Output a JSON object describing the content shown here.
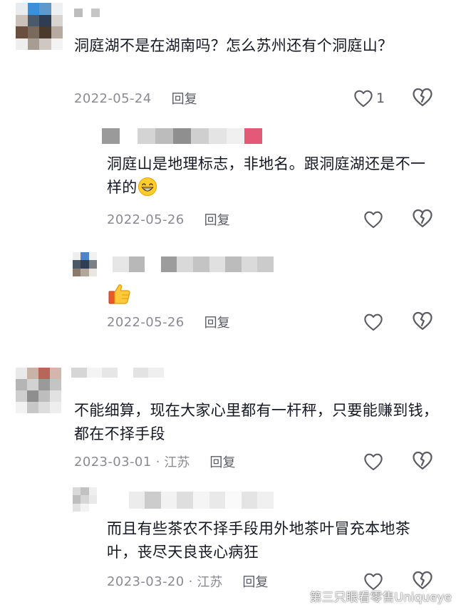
{
  "comments": [
    {
      "text": "洞庭湖不是在湖南吗？怎么苏州还有个洞庭山？",
      "date": "2022-05-24",
      "reply_label": "回复",
      "like_count": "1",
      "replies": [
        {
          "text": "洞庭山是地理标志，非地名。跟洞庭湖还是不一样的",
          "emoji": "grinning-emoji",
          "date": "2022-05-26",
          "reply_label": "回复"
        },
        {
          "emoji": "thumbs-up-emoji",
          "date": "2022-05-26",
          "reply_label": "回复"
        }
      ]
    },
    {
      "text": "不能细算，现在大家心里都有一杆秤，只要能赚到钱，都在不择手段",
      "date": "2023-03-01",
      "location_separator": "·",
      "location": "江苏",
      "reply_label": "回复",
      "replies": [
        {
          "text": "而且有些茶农不择手段用外地茶叶冒充本地茶叶，丧尽天良丧心病狂",
          "date": "2023-03-20",
          "location_separator": "·",
          "location": "江苏",
          "reply_label": "回复"
        }
      ]
    }
  ],
  "watermark": {
    "text": "第三只眼看零售Uniqueye",
    "icon": "weibo-icon"
  },
  "colors": {
    "text": "#161823",
    "meta": "#8a8b91",
    "icon": "#5b5c63"
  }
}
